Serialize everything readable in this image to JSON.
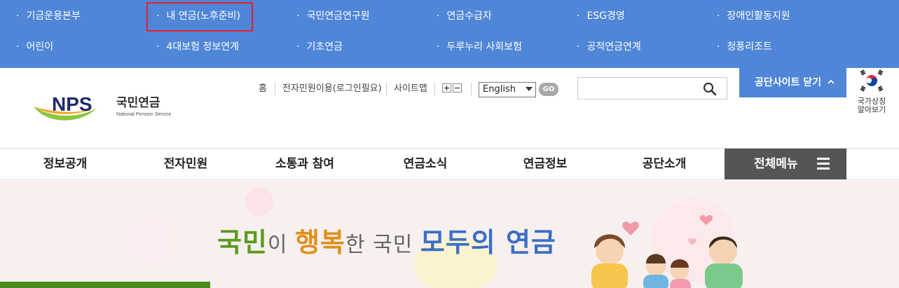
{
  "site_links": {
    "row1": [
      "기금운용본부",
      "내 연금(노후준비)",
      "국민연금연구원",
      "연금수급자",
      "ESG경영",
      "장애인활동지원"
    ],
    "row2": [
      "어린이",
      "4대보험 정보연계",
      "기초연금",
      "두루누리 사회보험",
      "공적연금연계",
      "청풍리조트"
    ]
  },
  "logo": {
    "mark": "NPS",
    "korean": "국민연금",
    "english": "National Pension Service"
  },
  "utility": {
    "home": "홈",
    "e_service": "전자민원이용(로그인필요)",
    "sitemap": "사이트맵",
    "font_plus": "+",
    "font_minus": "−"
  },
  "language": {
    "selected": "English",
    "go_label": "GO"
  },
  "search": {
    "placeholder": ""
  },
  "close_sites_label": "공단사이트 닫기",
  "flag_caption": [
    "국가상징",
    "알아보기"
  ],
  "nav": {
    "items": [
      "정보공개",
      "전자민원",
      "소통과 참여",
      "연금소식",
      "연금정보",
      "공단소개"
    ],
    "all_menu": "전체메뉴"
  },
  "hero": {
    "parts": [
      "국민",
      "이 ",
      "행복",
      "한 국민 ",
      "모두의 연금"
    ]
  },
  "colors": {
    "top_bar": "#4f86d8",
    "highlight_box": "#e3202c",
    "nav_all_bg": "#555555",
    "hero_green": "#5c9a1e",
    "hero_orange": "#e0901a",
    "hero_blue": "#3a6fc4",
    "hero_gray": "#666666"
  },
  "icons": {
    "search": "search-icon",
    "chevron": "chevron-up-icon",
    "menu": "hamburger-icon",
    "flag": "korean-flag-icon"
  }
}
